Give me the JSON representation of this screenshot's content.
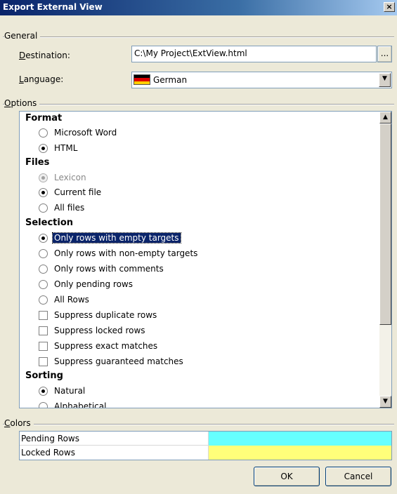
{
  "window": {
    "title": "Export External View",
    "close_glyph": "×"
  },
  "general": {
    "group_label": "General",
    "destination_label_u": "D",
    "destination_label_rest": "estination:",
    "destination_value": "C:\\My Project\\ExtView.html",
    "browse_label": "...",
    "language_label_u": "L",
    "language_label_rest": "anguage:",
    "language_value": "German",
    "language_flag_icon": "germany-flag-icon"
  },
  "options": {
    "group_label_u": "O",
    "group_label_rest": "ptions",
    "sections": {
      "format": "Format",
      "files": "Files",
      "selection": "Selection",
      "sorting": "Sorting"
    },
    "items": {
      "microsoft_word": "Microsoft Word",
      "html": "HTML",
      "lexicon": "Lexicon",
      "current_file": "Current file",
      "all_files": "All files",
      "only_empty": "Only rows with empty targets",
      "only_nonempty": "Only rows with non-empty targets",
      "only_comments": "Only rows with comments",
      "only_pending": "Only pending rows",
      "all_rows": "All Rows",
      "suppress_duplicate": "Suppress duplicate rows",
      "suppress_locked": "Suppress locked rows",
      "suppress_exact": "Suppress exact matches",
      "suppress_guaranteed": "Suppress guaranteed matches",
      "natural": "Natural",
      "alphabetical": "Alphabetical"
    },
    "selected": {
      "format": "html",
      "files": "current_file",
      "selection": "only_empty",
      "sorting": "natural"
    }
  },
  "colors": {
    "group_label_u": "C",
    "group_label_rest": "olors",
    "rows": [
      {
        "label": "Pending Rows",
        "color": "#66ffff"
      },
      {
        "label": "Locked Rows",
        "color": "#ffff7a"
      }
    ]
  },
  "buttons": {
    "ok": "OK",
    "cancel": "Cancel"
  }
}
